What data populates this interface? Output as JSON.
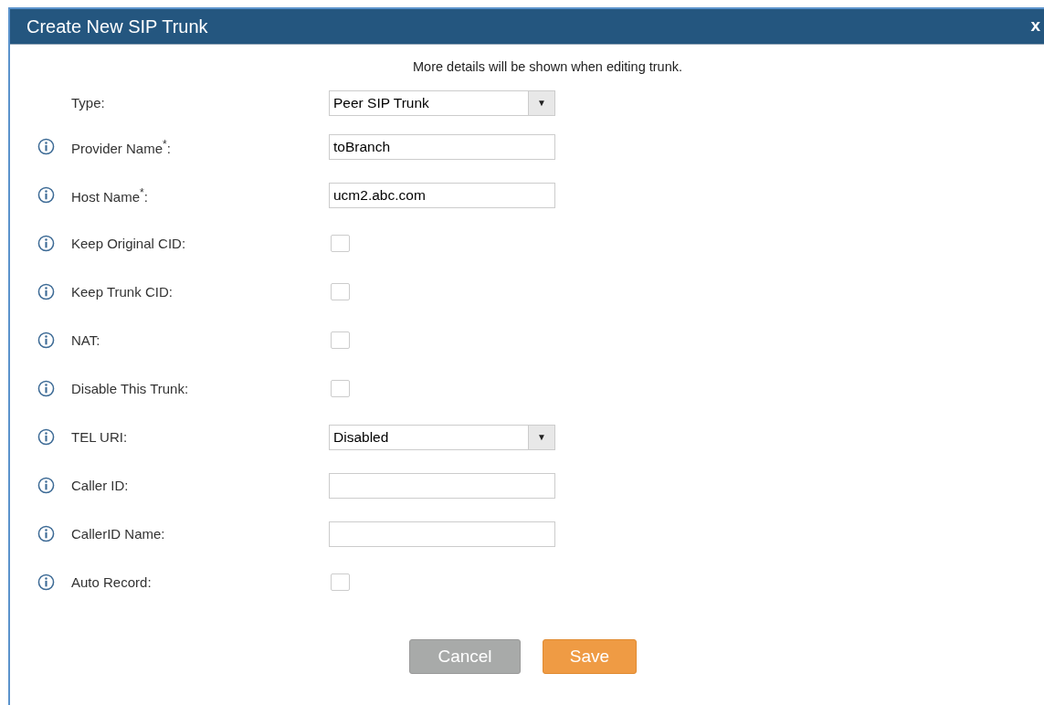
{
  "dialog": {
    "title": "Create New SIP Trunk",
    "close": "x",
    "note": "More details will be shown when editing trunk.",
    "fields": [
      {
        "kind": "select",
        "label": "Type:",
        "info": false,
        "value": "Peer SIP Trunk",
        "arrow": "▼"
      },
      {
        "kind": "text",
        "label": "Provider Name$^{*}$:",
        "info": true,
        "value": "toBranch"
      },
      {
        "kind": "text",
        "label": "Host Name$^{*}$:",
        "info": true,
        "value": "ucm2.abc.com"
      },
      {
        "kind": "checkbox",
        "label": "Keep Original CID:",
        "info": true,
        "checked": false
      },
      {
        "kind": "checkbox",
        "label": "Keep Trunk CID:",
        "info": true,
        "checked": false
      },
      {
        "kind": "checkbox",
        "label": "NAT:",
        "info": true,
        "checked": false
      },
      {
        "kind": "checkbox",
        "label": "Disable This Trunk:",
        "info": true,
        "checked": false
      },
      {
        "kind": "select",
        "label": "TEL URI:",
        "info": true,
        "value": "Disabled",
        "arrow": "▼"
      },
      {
        "kind": "text",
        "label": "Caller ID:",
        "info": true
      },
      {
        "kind": "text",
        "label": "CallerID Name:",
        "info": true
      },
      {
        "kind": "checkbox",
        "label": "Auto Record:",
        "info": true,
        "checked": false
      }
    ],
    "buttons": [
      {
        "kind": "cancel",
        "label": "Cancel"
      },
      {
        "kind": "save",
        "label": "Save"
      }
    ]
  }
}
